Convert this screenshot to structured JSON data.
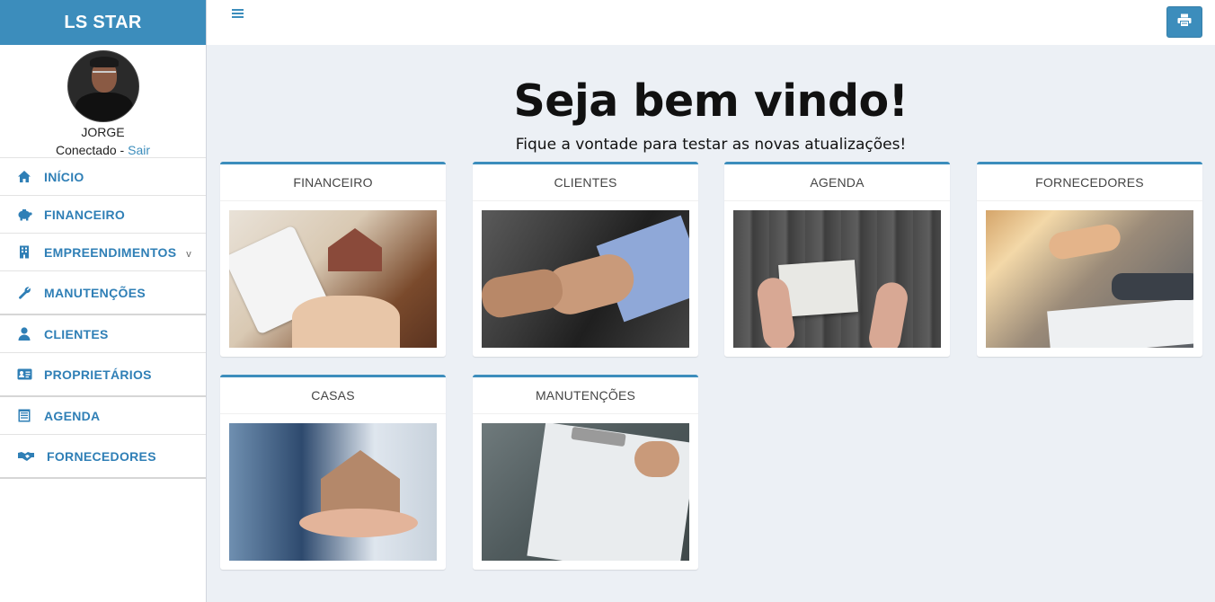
{
  "brand": "LS STAR",
  "user": {
    "name": "JORGE",
    "status_prefix": "Conectado - ",
    "logout_label": "Sair"
  },
  "menu": [
    {
      "label": "INÍCIO",
      "icon": "home-icon"
    },
    {
      "label": "FINANCEIRO",
      "icon": "piggy-bank-icon"
    },
    {
      "label": "EMPREENDIMENTOS",
      "icon": "building-icon",
      "caret": "v"
    },
    {
      "label": "MANUTENÇÕES",
      "icon": "wrench-icon"
    },
    {
      "label": "CLIENTES",
      "icon": "user-icon"
    },
    {
      "label": "PROPRIETÁRIOS",
      "icon": "id-card-icon"
    },
    {
      "label": "AGENDA",
      "icon": "calendar-icon"
    },
    {
      "label": "FORNECEDORES",
      "icon": "handshake-icon"
    }
  ],
  "header": {
    "menu_toggle_icon": "hamburger-icon",
    "print_icon": "printer-icon"
  },
  "welcome": {
    "title": "Seja bem vindo!",
    "subtitle": "Fique a vontade para testar as novas atualizações!"
  },
  "cards": [
    {
      "title": "FINANCEIRO",
      "image": "calculator-house-photo"
    },
    {
      "title": "CLIENTES",
      "image": "handshake-photo"
    },
    {
      "title": "AGENDA",
      "image": "notebook-desk-photo"
    },
    {
      "title": "FORNECEDORES",
      "image": "business-handshake-photo"
    },
    {
      "title": "CASAS",
      "image": "house-model-photo"
    },
    {
      "title": "MANUTENÇÕES",
      "image": "daily-report-photo"
    }
  ],
  "colors": {
    "brand": "#3c8dbc",
    "menu_text": "#2f7fb6",
    "background": "#ecf0f5"
  }
}
